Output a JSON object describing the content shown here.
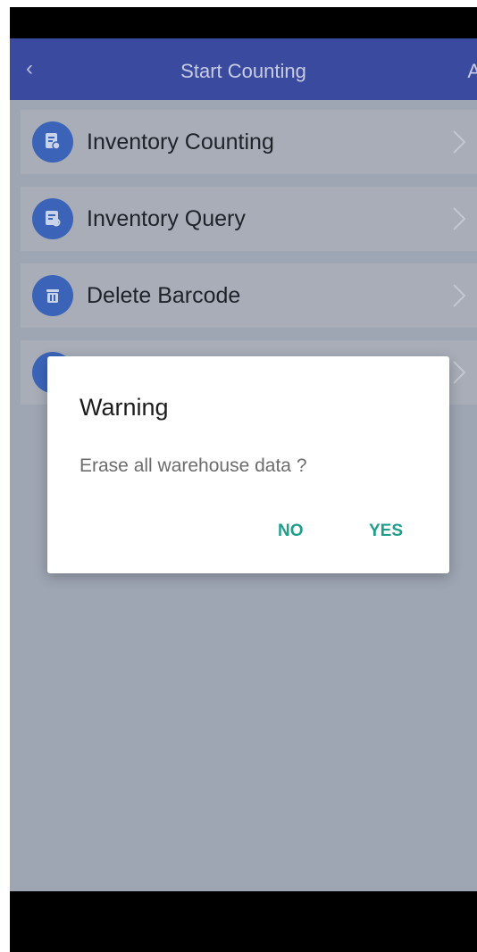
{
  "header": {
    "back_icon": "chevron-left-icon",
    "title": "Start Counting",
    "right_label": "A"
  },
  "menu": {
    "items": [
      {
        "label": "Inventory Counting",
        "icon": "inventory-counting-icon"
      },
      {
        "label": "Inventory Query",
        "icon": "inventory-query-icon"
      },
      {
        "label": "Delete Barcode",
        "icon": "trash-icon"
      },
      {
        "label": "",
        "icon": "settings-icon"
      }
    ]
  },
  "dialog": {
    "title": "Warning",
    "message": "Erase all warehouse data ?",
    "no_label": "NO",
    "yes_label": "YES"
  },
  "colors": {
    "nav_bar": "#3a4b9f",
    "icon_bg": "#3b64b9",
    "dialog_button": "#1f9e8c",
    "overlay": "#9ea5b3"
  }
}
